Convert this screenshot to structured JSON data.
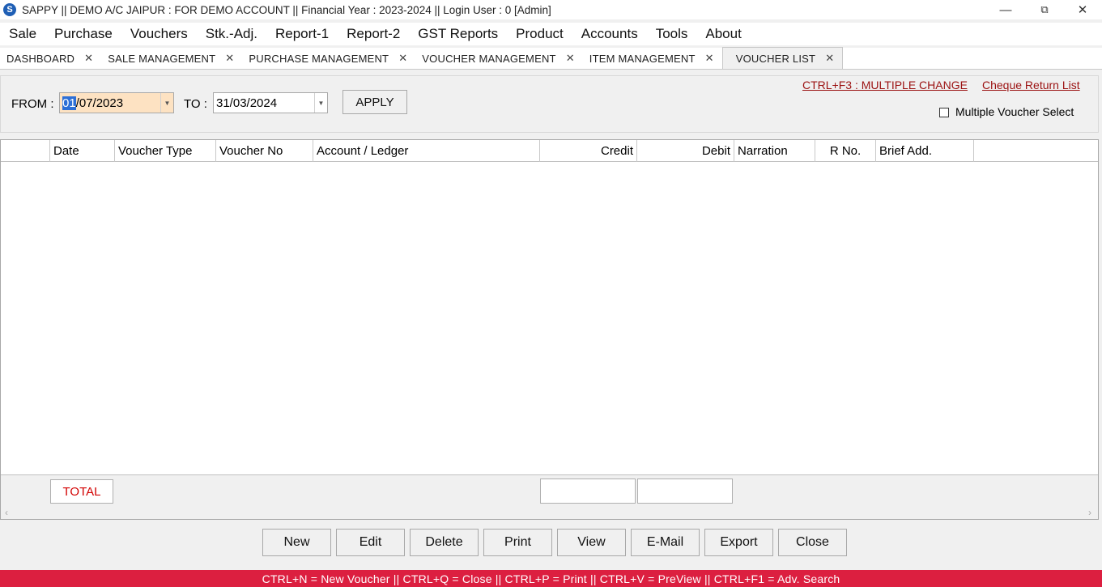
{
  "window": {
    "icon": "sappy-app-icon",
    "title": "SAPPY || DEMO A/C JAIPUR : FOR DEMO ACCOUNT || Financial Year : 2023-2024 || Login User : 0 [Admin]",
    "minimize": "—",
    "restore": "⧉",
    "close": "✕"
  },
  "menu": [
    "Sale",
    "Purchase",
    "Vouchers",
    "Stk.-Adj.",
    "Report-1",
    "Report-2",
    "GST Reports",
    "Product",
    "Accounts",
    "Tools",
    "About"
  ],
  "tabs": [
    {
      "label": "DASHBOARD",
      "close": "✕"
    },
    {
      "label": "SALE MANAGEMENT",
      "close": "✕"
    },
    {
      "label": "PURCHASE MANAGEMENT",
      "close": "✕"
    },
    {
      "label": "VOUCHER MANAGEMENT",
      "close": "✕"
    },
    {
      "label": "ITEM MANAGEMENT",
      "close": "✕"
    },
    {
      "label": "VOUCHER LIST",
      "close": "✕",
      "active": true
    }
  ],
  "filter": {
    "from_label": "FROM :",
    "from_selected": "01",
    "from_rest": "/07/2023",
    "to_label": "TO :",
    "to_value": "31/03/2024",
    "apply_label": "APPLY",
    "multiple_change_link": "CTRL+F3 : MULTIPLE CHANGE",
    "cheque_return_link": "Cheque Return List",
    "multiple_select_label": "Multiple Voucher Select",
    "multiple_select_checked": false
  },
  "grid": {
    "columns": [
      "",
      "Date",
      "Voucher Type",
      "Voucher No",
      "Account / Ledger",
      "Credit",
      "Debit",
      "Narration",
      "R No.",
      "Brief Add."
    ],
    "rows": [],
    "total_label": "TOTAL",
    "total_credit": "",
    "total_debit": ""
  },
  "actions": [
    "New",
    "Edit",
    "Delete",
    "Print",
    "View",
    "E-Mail",
    "Export",
    "Close"
  ],
  "status": {
    "text": "CTRL+N = New Voucher || CTRL+Q = Close || CTRL+P = Print || CTRL+V = PreView || CTRL+F1 = Adv. Search",
    "color": "#dc1f40"
  }
}
